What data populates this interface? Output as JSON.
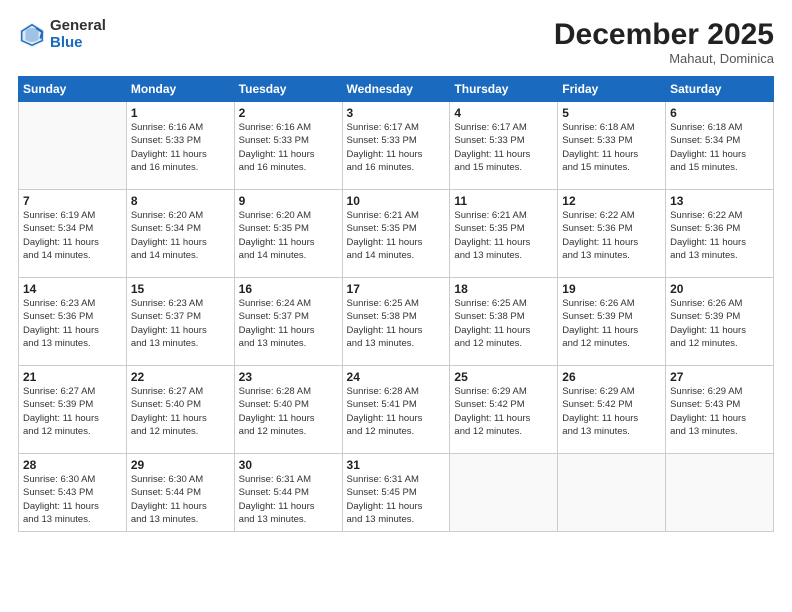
{
  "logo": {
    "general": "General",
    "blue": "Blue"
  },
  "title": "December 2025",
  "subtitle": "Mahaut, Dominica",
  "days_header": [
    "Sunday",
    "Monday",
    "Tuesday",
    "Wednesday",
    "Thursday",
    "Friday",
    "Saturday"
  ],
  "weeks": [
    [
      {
        "day": "",
        "info": ""
      },
      {
        "day": "1",
        "info": "Sunrise: 6:16 AM\nSunset: 5:33 PM\nDaylight: 11 hours\nand 16 minutes."
      },
      {
        "day": "2",
        "info": "Sunrise: 6:16 AM\nSunset: 5:33 PM\nDaylight: 11 hours\nand 16 minutes."
      },
      {
        "day": "3",
        "info": "Sunrise: 6:17 AM\nSunset: 5:33 PM\nDaylight: 11 hours\nand 16 minutes."
      },
      {
        "day": "4",
        "info": "Sunrise: 6:17 AM\nSunset: 5:33 PM\nDaylight: 11 hours\nand 15 minutes."
      },
      {
        "day": "5",
        "info": "Sunrise: 6:18 AM\nSunset: 5:33 PM\nDaylight: 11 hours\nand 15 minutes."
      },
      {
        "day": "6",
        "info": "Sunrise: 6:18 AM\nSunset: 5:34 PM\nDaylight: 11 hours\nand 15 minutes."
      }
    ],
    [
      {
        "day": "7",
        "info": "Sunrise: 6:19 AM\nSunset: 5:34 PM\nDaylight: 11 hours\nand 14 minutes."
      },
      {
        "day": "8",
        "info": "Sunrise: 6:20 AM\nSunset: 5:34 PM\nDaylight: 11 hours\nand 14 minutes."
      },
      {
        "day": "9",
        "info": "Sunrise: 6:20 AM\nSunset: 5:35 PM\nDaylight: 11 hours\nand 14 minutes."
      },
      {
        "day": "10",
        "info": "Sunrise: 6:21 AM\nSunset: 5:35 PM\nDaylight: 11 hours\nand 14 minutes."
      },
      {
        "day": "11",
        "info": "Sunrise: 6:21 AM\nSunset: 5:35 PM\nDaylight: 11 hours\nand 13 minutes."
      },
      {
        "day": "12",
        "info": "Sunrise: 6:22 AM\nSunset: 5:36 PM\nDaylight: 11 hours\nand 13 minutes."
      },
      {
        "day": "13",
        "info": "Sunrise: 6:22 AM\nSunset: 5:36 PM\nDaylight: 11 hours\nand 13 minutes."
      }
    ],
    [
      {
        "day": "14",
        "info": "Sunrise: 6:23 AM\nSunset: 5:36 PM\nDaylight: 11 hours\nand 13 minutes."
      },
      {
        "day": "15",
        "info": "Sunrise: 6:23 AM\nSunset: 5:37 PM\nDaylight: 11 hours\nand 13 minutes."
      },
      {
        "day": "16",
        "info": "Sunrise: 6:24 AM\nSunset: 5:37 PM\nDaylight: 11 hours\nand 13 minutes."
      },
      {
        "day": "17",
        "info": "Sunrise: 6:25 AM\nSunset: 5:38 PM\nDaylight: 11 hours\nand 13 minutes."
      },
      {
        "day": "18",
        "info": "Sunrise: 6:25 AM\nSunset: 5:38 PM\nDaylight: 11 hours\nand 12 minutes."
      },
      {
        "day": "19",
        "info": "Sunrise: 6:26 AM\nSunset: 5:39 PM\nDaylight: 11 hours\nand 12 minutes."
      },
      {
        "day": "20",
        "info": "Sunrise: 6:26 AM\nSunset: 5:39 PM\nDaylight: 11 hours\nand 12 minutes."
      }
    ],
    [
      {
        "day": "21",
        "info": "Sunrise: 6:27 AM\nSunset: 5:39 PM\nDaylight: 11 hours\nand 12 minutes."
      },
      {
        "day": "22",
        "info": "Sunrise: 6:27 AM\nSunset: 5:40 PM\nDaylight: 11 hours\nand 12 minutes."
      },
      {
        "day": "23",
        "info": "Sunrise: 6:28 AM\nSunset: 5:40 PM\nDaylight: 11 hours\nand 12 minutes."
      },
      {
        "day": "24",
        "info": "Sunrise: 6:28 AM\nSunset: 5:41 PM\nDaylight: 11 hours\nand 12 minutes."
      },
      {
        "day": "25",
        "info": "Sunrise: 6:29 AM\nSunset: 5:42 PM\nDaylight: 11 hours\nand 12 minutes."
      },
      {
        "day": "26",
        "info": "Sunrise: 6:29 AM\nSunset: 5:42 PM\nDaylight: 11 hours\nand 13 minutes."
      },
      {
        "day": "27",
        "info": "Sunrise: 6:29 AM\nSunset: 5:43 PM\nDaylight: 11 hours\nand 13 minutes."
      }
    ],
    [
      {
        "day": "28",
        "info": "Sunrise: 6:30 AM\nSunset: 5:43 PM\nDaylight: 11 hours\nand 13 minutes."
      },
      {
        "day": "29",
        "info": "Sunrise: 6:30 AM\nSunset: 5:44 PM\nDaylight: 11 hours\nand 13 minutes."
      },
      {
        "day": "30",
        "info": "Sunrise: 6:31 AM\nSunset: 5:44 PM\nDaylight: 11 hours\nand 13 minutes."
      },
      {
        "day": "31",
        "info": "Sunrise: 6:31 AM\nSunset: 5:45 PM\nDaylight: 11 hours\nand 13 minutes."
      },
      {
        "day": "",
        "info": ""
      },
      {
        "day": "",
        "info": ""
      },
      {
        "day": "",
        "info": ""
      }
    ]
  ]
}
